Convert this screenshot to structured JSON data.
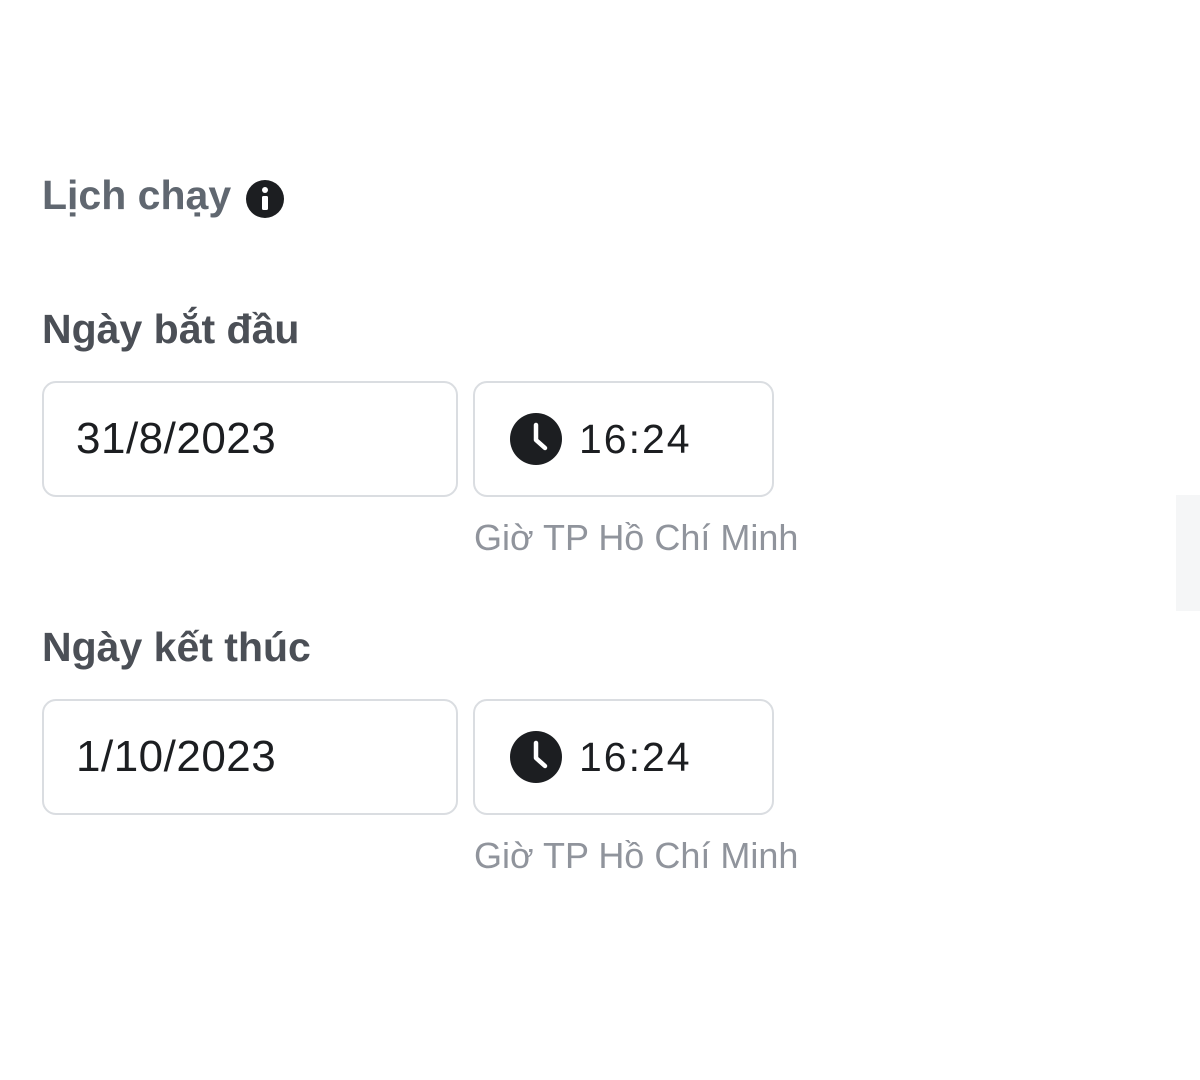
{
  "schedule": {
    "title": "Lịch chạy",
    "info_icon": "info-circle-icon"
  },
  "start": {
    "label": "Ngày bắt đầu",
    "date": "31/8/2023",
    "time": "16:24",
    "timezone": "Giờ TP Hồ Chí Minh",
    "time_icon": "clock-icon"
  },
  "end": {
    "label": "Ngày kết thúc",
    "date": "1/10/2023",
    "time": "16:24",
    "timezone": "Giờ TP Hồ Chí Minh",
    "time_icon": "clock-icon"
  },
  "colors": {
    "text_primary": "#1c1e21",
    "text_secondary": "#606770",
    "text_muted": "#90949c",
    "border": "#dadde1",
    "icon": "#1c1e21"
  }
}
